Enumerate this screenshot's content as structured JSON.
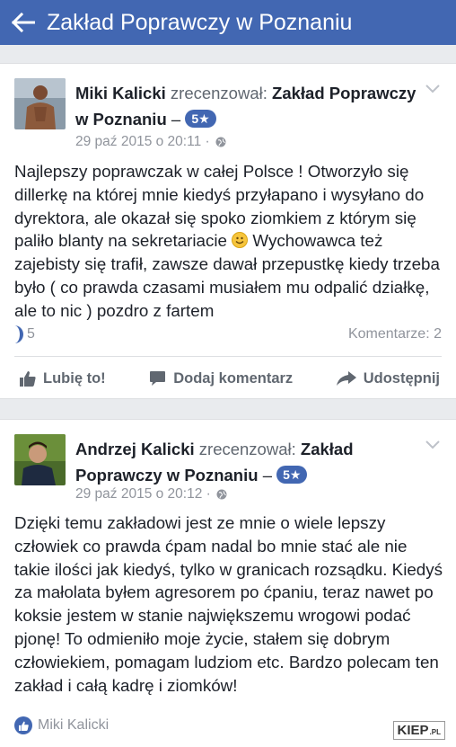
{
  "header": {
    "title": "Zakład Poprawczy w Poznaniu"
  },
  "reviews": [
    {
      "author": "Miki Kalicki",
      "verb": "zrecenzował:",
      "page": "Zakład Poprawczy w Poznaniu",
      "dash": "–",
      "rating": "5★",
      "timestamp": "29 paź 2015 o 20:11 ·",
      "text_before_emoji": "Najlepszy poprawczak w całej Polsce ! Otworzyło się dillerkę na której mnie kiedyś przyłapano i wysyłano do dyrektora, ale okazał się spoko ziomkiem z którym się paliło blanty na sekretariacie ",
      "text_after_emoji": " Wychowawca też zajebisty się trafił, zawsze dawał przepustkę kiedy trzeba było ( co prawda czasami musiałem mu odpalić działkę, ale to nic ) pozdro z fartem",
      "likes": "5",
      "comments": "Komentarze: 2",
      "actions": {
        "like": "Lubię to!",
        "comment": "Dodaj komentarz",
        "share": "Udostępnij"
      }
    },
    {
      "author": "Andrzej Kalicki",
      "verb": "zrecenzował:",
      "page": "Zakład Poprawczy w Poznaniu",
      "dash": "–",
      "rating": "5★",
      "timestamp": "29 paź 2015 o 20:12 ·",
      "text": "Dzięki temu zakładowi jest ze mnie o wiele lepszy człowiek co prawda ćpam nadal bo mnie stać ale nie takie ilości jak kiedyś, tylko w granicach rozsądku. Kiedyś za małolata byłem agresorem po ćpaniu, teraz nawet po koksie jestem w stanie największemu wrogowi podać pjonę! To odmieniło moje życie, stałem się dobrym człowiekiem, pomagam ludziom etc. Bardzo polecam ten zakład i całą kadrę i ziomków!",
      "liked_by": "Miki Kalicki"
    }
  ],
  "watermark": {
    "main": "KIEP",
    "suffix": ".PL"
  },
  "colors": {
    "brand": "#4267b2",
    "meta": "#90949c"
  }
}
